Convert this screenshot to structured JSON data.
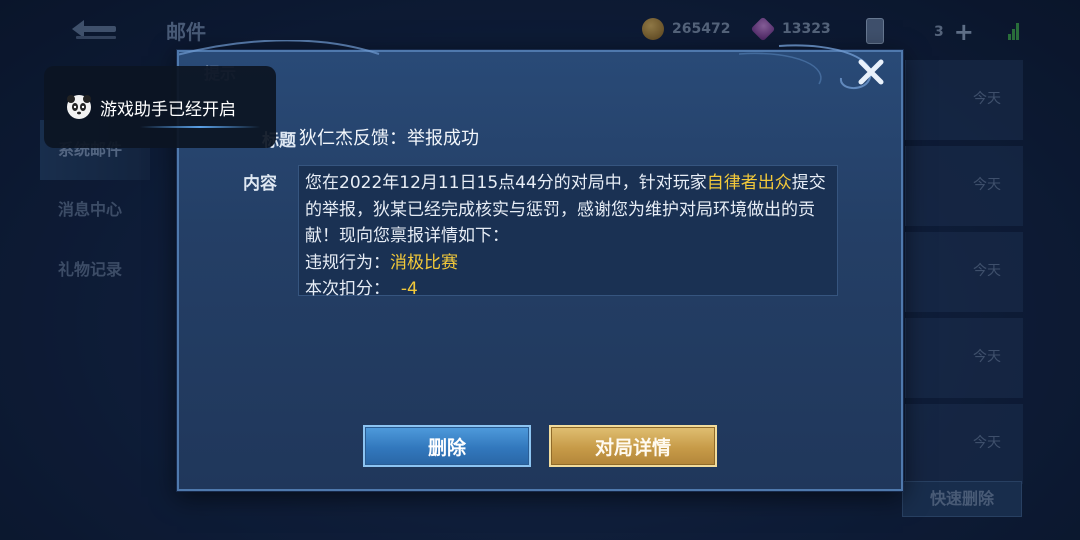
{
  "topbar": {
    "page_title": "邮件",
    "coins": "265472",
    "gems": "13323",
    "cards": "3",
    "add_symbol": "+"
  },
  "side_tabs": [
    {
      "label": "系统邮件",
      "active": true
    },
    {
      "label": "消息中心",
      "active": false
    },
    {
      "label": "礼物记录",
      "active": false
    }
  ],
  "mail_list": [
    {
      "time": "今天"
    },
    {
      "time": "今天"
    },
    {
      "time": "今天"
    },
    {
      "time": "今天"
    },
    {
      "time": "今天"
    }
  ],
  "quick_delete_label": "快速删除",
  "dialog": {
    "tip_label": "提示",
    "subject_label": "标题",
    "subject": "狄仁杰反馈：举报成功",
    "content_label": "内容",
    "content": {
      "part1": "您在2022年12月11日15点44分的对局中，针对玩家",
      "player": "自律者出众",
      "part2": "提交的举报，狄某已经完成核实与惩罚，感谢您为维护对局环境做出的贡献！现向您禀报详情如下：",
      "violation_label": "违规行为：",
      "violation": "消极比赛",
      "deduct_label": "本次扣分：",
      "deduct": "-4"
    },
    "delete_button": "删除",
    "detail_button": "对局详情"
  },
  "toast": {
    "text": "游戏助手已经开启"
  },
  "colors": {
    "highlight": "#f3c93a",
    "delete_button": "#3f88cc",
    "detail_button": "#c9a050"
  }
}
